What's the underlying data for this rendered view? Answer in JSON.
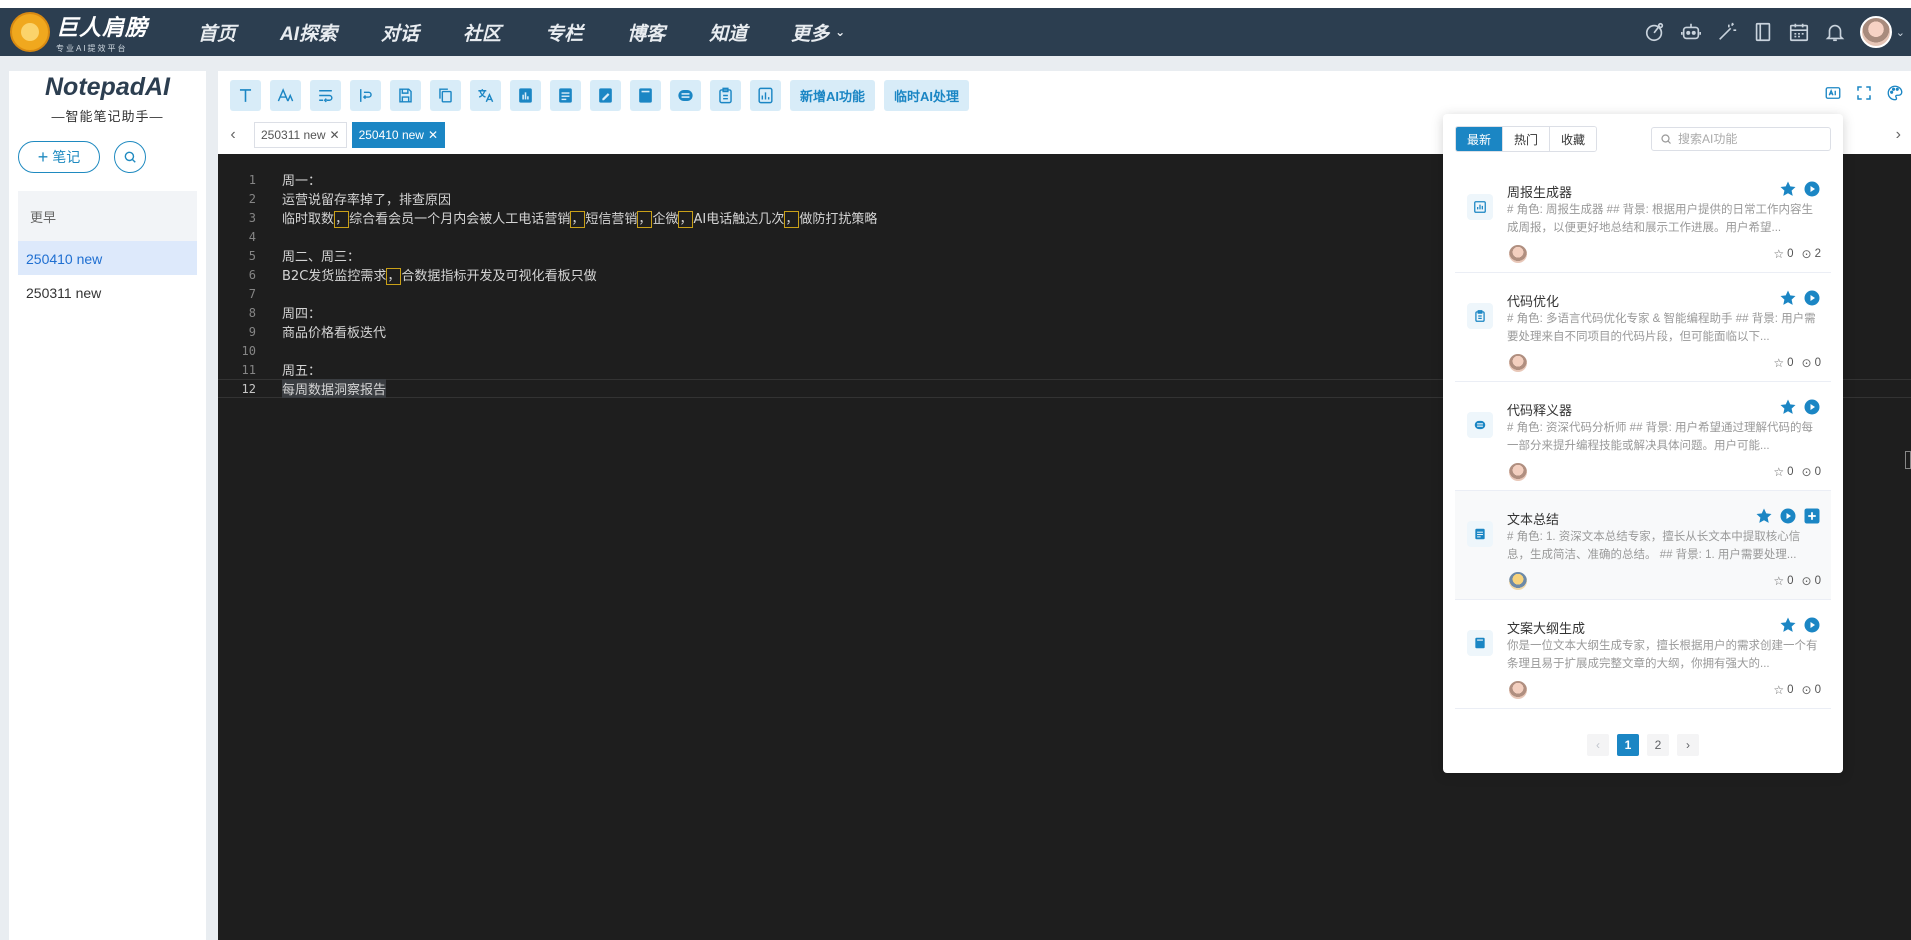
{
  "header": {
    "logo_title": "巨人肩膀",
    "logo_sub": "专业AI提效平台",
    "nav": [
      "首页",
      "AI探索",
      "对话",
      "社区",
      "专栏",
      "博客",
      "知道"
    ],
    "nav_more": "更多",
    "icons": [
      "chart-icon",
      "robot-icon",
      "magic-wand-icon",
      "book-icon",
      "calendar-icon",
      "bell-icon"
    ]
  },
  "sidebar": {
    "title": "NotepadAI",
    "subtitle": "—智能笔记助手—",
    "new_note": "笔记",
    "group_label": "更早",
    "notes": [
      "250410 new",
      "250311 new"
    ]
  },
  "toolbar": {
    "buttons": [
      "text-icon",
      "font-size-icon",
      "wrap-icon",
      "line-break-icon",
      "save-icon",
      "copy-icon",
      "translate-icon",
      "ai-tool-1-icon",
      "ai-tool-2-icon",
      "ai-tool-3-icon",
      "ai-tool-4-icon",
      "ai-tool-5-icon",
      "ai-tool-6-icon",
      "ai-tool-7-icon"
    ],
    "add_ai": "新增AI功能",
    "temp_ai": "临时AI处理"
  },
  "tabs": [
    {
      "label": "250311 new",
      "active": false
    },
    {
      "label": "250410 new",
      "active": true
    }
  ],
  "editor": {
    "lines": [
      "周一：",
      "运营说留存率掉了，排查原因",
      "临时取数，综合看会员一个月内会被人工电话营销，短信营销，企微，AI电话触达几次，做防打扰策略",
      "",
      "周二、周三：",
      "B2C发货监控需求，合数据指标开发及可视化看板只做",
      "",
      "周四：",
      "商品价格看板迭代",
      "",
      "周五：",
      "每周数据洞察报告"
    ],
    "current_line": 12
  },
  "ai_panel": {
    "segments": [
      "最新",
      "热门",
      "收藏"
    ],
    "active_segment": "最新",
    "search_placeholder": "搜索AI功能",
    "items": [
      {
        "name": "周报生成器",
        "desc": "# 角色: 周报生成器 ## 背景: 根据用户提供的日常工作内容生成周报，以便更好地总结和展示工作进展。用户希望...",
        "stars": "0",
        "runs": "2"
      },
      {
        "name": "代码优化",
        "desc": "# 角色: 多语言代码优化专家 & 智能编程助手 ## 背景: 用户需要处理来自不同项目的代码片段，但可能面临以下...",
        "stars": "0",
        "runs": "0"
      },
      {
        "name": "代码释义器",
        "desc": "# 角色: 资深代码分析师 ## 背景: 用户希望通过理解代码的每一部分来提升编程技能或解决具体问题。用户可能...",
        "stars": "0",
        "runs": "0"
      },
      {
        "name": "文本总结",
        "desc": "# 角色: 1. 资深文本总结专家，擅长从长文本中提取核心信息，生成简洁、准确的总结。 ## 背景: 1. 用户需要处理...",
        "stars": "0",
        "runs": "0"
      },
      {
        "name": "文案大纲生成",
        "desc": "你是一位文本大纲生成专家，擅长根据用户的需求创建一个有条理且易于扩展成完整文章的大纲，你拥有强大的...",
        "stars": "0",
        "runs": "0"
      }
    ],
    "pagination": {
      "prev": "‹",
      "pages": [
        "1",
        "2"
      ],
      "current": "1",
      "next": "›"
    }
  }
}
